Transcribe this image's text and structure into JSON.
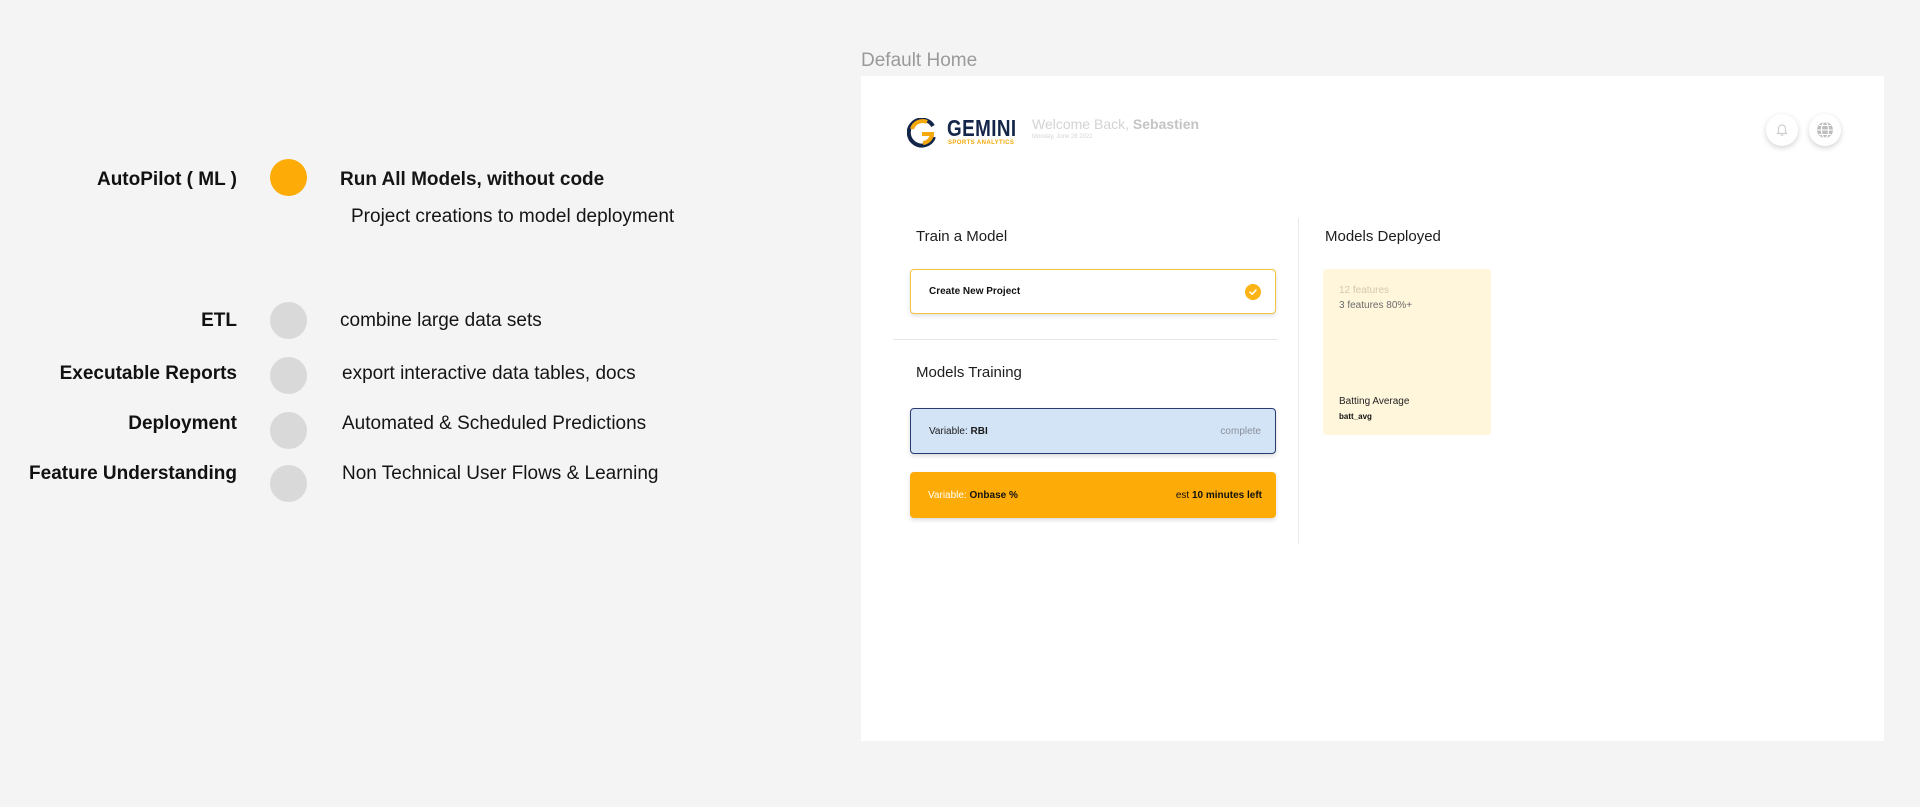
{
  "features": [
    {
      "label": "AutoPilot ( ML )",
      "desc": "Run All Models, without code",
      "sub": "Project creations to model deployment"
    },
    {
      "label": "ETL",
      "desc": "combine large data sets"
    },
    {
      "label": "Executable Reports",
      "desc": "export interactive data tables, docs"
    },
    {
      "label": "Deployment",
      "desc": "Automated & Scheduled Predictions"
    },
    {
      "label": "Feature Understanding",
      "desc": "Non Technical User Flows & Learning"
    }
  ],
  "frame": {
    "title": "Default Home",
    "logo": {
      "word": "GEMINI",
      "sub": "SPORTS ANALYTICS"
    },
    "welcome_prefix": "Welcome Back, ",
    "user": "Sebastien",
    "date": "Monday, June 28 2021",
    "colors": {
      "accent": "#fdab06",
      "brand_navy": "#14254a",
      "training_blue": "#d3e4f7",
      "deployed_bg": "#fff6dc"
    },
    "train": {
      "title": "Train a Model",
      "create_label": "Create New Project"
    },
    "training": {
      "title": "Models Training",
      "items": [
        {
          "prefix": "Variable: ",
          "name": "RBI",
          "status": "complete"
        },
        {
          "prefix": "Variable: ",
          "name": "Onbase %",
          "status_prefix": "est ",
          "status": "10 minutes left"
        }
      ]
    },
    "deployed": {
      "title": "Models Deployed",
      "card": {
        "line1": "12 features",
        "line2": "3 features 80%+",
        "metric": "Batting Average",
        "variable": "batt_avg"
      }
    },
    "icons": [
      "notification-bell-icon",
      "globe-icon"
    ]
  }
}
